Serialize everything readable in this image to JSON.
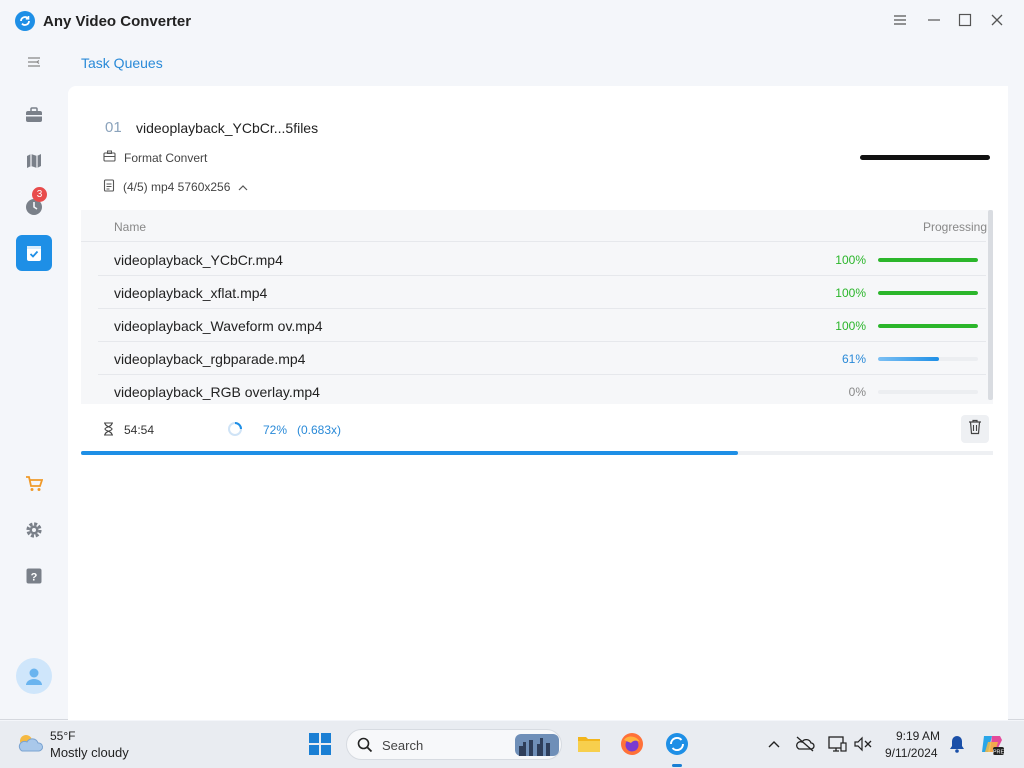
{
  "app": {
    "title": "Any Video Converter"
  },
  "colors": {
    "accent": "#1e8fe6",
    "green": "#2bb62b",
    "badge": "#e84c4c"
  },
  "sidebar": {
    "items": [
      {
        "name": "menu-icon"
      },
      {
        "name": "toolbox-icon"
      },
      {
        "name": "map-icon"
      },
      {
        "name": "history-icon",
        "badge": "3"
      },
      {
        "name": "task-queue-icon",
        "active": true
      },
      {
        "name": "cart-icon"
      },
      {
        "name": "settings-icon"
      },
      {
        "name": "help-icon"
      }
    ]
  },
  "page": {
    "title": "Task Queues"
  },
  "task": {
    "index": "01",
    "name": "videoplayback_YCbCr...5files",
    "type": "Format Convert",
    "details": "(4/5) mp4 5760x256",
    "columns": {
      "name": "Name",
      "progress": "Progressing"
    },
    "files": [
      {
        "name": "videoplayback_YCbCr.mp4",
        "percent": "100%",
        "progress": 1.0,
        "state": "done"
      },
      {
        "name": "videoplayback_xflat.mp4",
        "percent": "100%",
        "progress": 1.0,
        "state": "done"
      },
      {
        "name": "videoplayback_Waveform ov.mp4",
        "percent": "100%",
        "progress": 1.0,
        "state": "done"
      },
      {
        "name": "videoplayback_rgbparade.mp4",
        "percent": "61%",
        "progress": 0.61,
        "state": "active"
      },
      {
        "name": "videoplayback_RGB overlay.mp4",
        "percent": "0%",
        "progress": 0.0,
        "state": "pending"
      }
    ],
    "elapsed": "54:54",
    "overall_percent": "72%",
    "speed": "(0.683x)",
    "overall_progress": 0.72
  },
  "taskbar": {
    "weather_temp": "55°F",
    "weather_desc": "Mostly cloudy",
    "search_label": "Search",
    "time": "9:19 AM",
    "date": "9/11/2024"
  }
}
